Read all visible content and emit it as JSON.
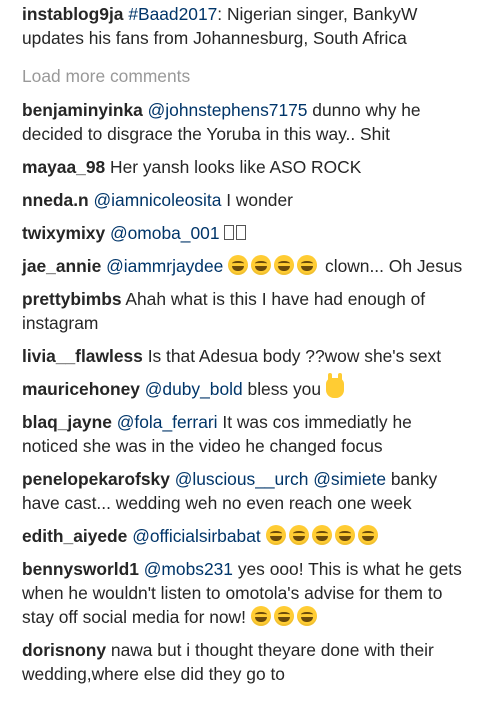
{
  "caption": {
    "username": "instablog9ja",
    "hashtag": "#Baad2017",
    "text": ": Nigerian singer, BankyW updates his fans from Johannesburg, South Africa"
  },
  "load_more_label": "Load more comments",
  "comments": [
    {
      "username": "benjaminyinka",
      "mention": "@johnstephens7175",
      "text": " dunno why he decided to disgrace the Yoruba in this way.. Shit"
    },
    {
      "username": "mayaa_98",
      "text": " Her yansh looks like ASO ROCK"
    },
    {
      "username": "nneda.n",
      "mention": "@iamnicoleosita",
      "text": " I wonder"
    },
    {
      "username": "twixymixy",
      "mention": "@omoba_001",
      "text": " "
    },
    {
      "username": "jae_annie",
      "mention": "@iammrjaydee",
      "text": " clown... Oh Jesus"
    },
    {
      "username": "prettybimbs",
      "text": " Ahah what is this I have had enough of instagram"
    },
    {
      "username": "livia__flawless",
      "text": " Is that Adesua body ??wow she's sext"
    },
    {
      "username": "mauricehoney",
      "mention": "@duby_bold",
      "text": " bless you "
    },
    {
      "username": "blaq_jayne",
      "mention": "@fola_ferrari",
      "text": " It was cos immediatly he noticed she was in the video he changed focus"
    },
    {
      "username": "penelopekarofsky",
      "mention": "@luscious__urch",
      "mention2": "@simiete",
      "text": " banky have cast... wedding weh no even reach one week"
    },
    {
      "username": "edith_aiyede",
      "mention": "@officialsirbabat",
      "text": " "
    },
    {
      "username": "bennysworld1",
      "mention": "@mobs231",
      "text": " yes ooo! This is what he gets when he wouldn't listen to omotola's advise for them to stay off social media for now! "
    },
    {
      "username": "dorisnony",
      "text": " nawa but i thought theyare done with their wedding,where else did they go to"
    }
  ],
  "colors": {
    "username": "#262626",
    "mention": "#003569",
    "muted": "#999999",
    "emoji": "#ffcc33"
  }
}
